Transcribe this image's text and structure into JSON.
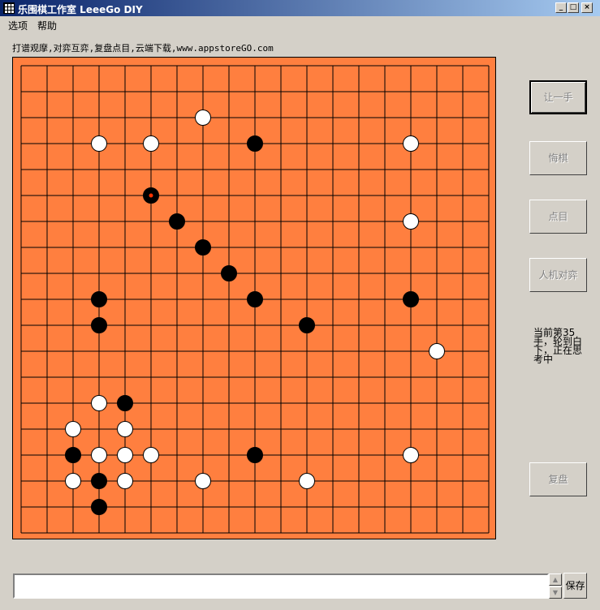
{
  "window": {
    "title": "乐围棋工作室 LeeeGo DIY",
    "minimize": "_",
    "maximize": "□",
    "close": "×"
  },
  "menu": [
    "选项",
    "帮助"
  ],
  "info": "打谱观摩,对弈互弈,复盘点目,云端下载,www.appstoreGO.com",
  "buttons": {
    "handicap": "让一手",
    "undo": "悔棋",
    "count": "点目",
    "vs_computer": "人机对弈",
    "review": "复盘",
    "save": "保存"
  },
  "status": "当前第35手，轮到白下，正在思考中",
  "comment_box": "",
  "colors": {
    "board": "#ff7f3f",
    "last_move_marker": "#ff3300"
  },
  "board": {
    "size": 19,
    "last_move": [
      5,
      5
    ],
    "black": [
      [
        9,
        3
      ],
      [
        5,
        5
      ],
      [
        6,
        6
      ],
      [
        7,
        7
      ],
      [
        8,
        8
      ],
      [
        3,
        9
      ],
      [
        9,
        9
      ],
      [
        15,
        9
      ],
      [
        3,
        10
      ],
      [
        11,
        10
      ],
      [
        4,
        13
      ],
      [
        2,
        15
      ],
      [
        9,
        15
      ],
      [
        3,
        16
      ],
      [
        3,
        17
      ]
    ],
    "white": [
      [
        7,
        2
      ],
      [
        3,
        3
      ],
      [
        5,
        3
      ],
      [
        15,
        3
      ],
      [
        15,
        6
      ],
      [
        16,
        11
      ],
      [
        3,
        13
      ],
      [
        2,
        14
      ],
      [
        4,
        14
      ],
      [
        3,
        15
      ],
      [
        4,
        15
      ],
      [
        5,
        15
      ],
      [
        15,
        15
      ],
      [
        2,
        16
      ],
      [
        4,
        16
      ],
      [
        7,
        16
      ],
      [
        11,
        16
      ]
    ]
  }
}
